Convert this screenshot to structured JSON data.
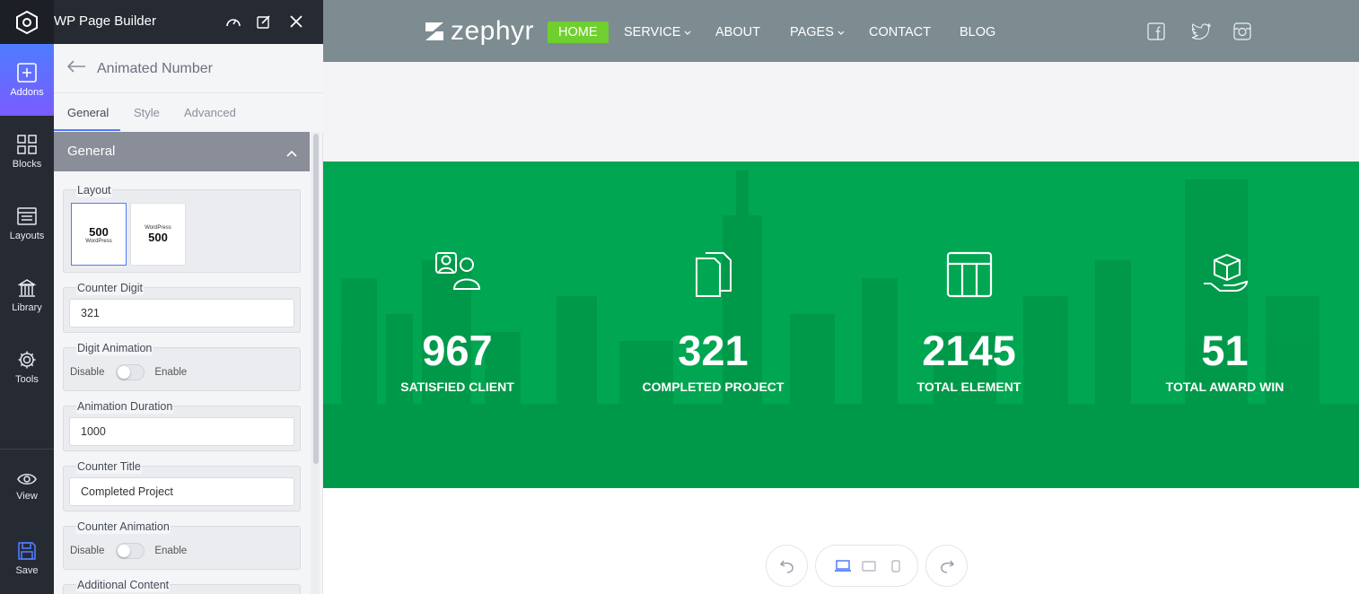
{
  "builder": {
    "title": "WP Page Builder",
    "rail": [
      {
        "label": "Addons",
        "icon": "plus-square-icon",
        "active": true
      },
      {
        "label": "Blocks",
        "icon": "blocks-icon"
      },
      {
        "label": "Layouts",
        "icon": "layouts-icon"
      },
      {
        "label": "Library",
        "icon": "library-icon"
      },
      {
        "label": "Tools",
        "icon": "gear-icon"
      },
      {
        "label": "View",
        "icon": "eye-icon"
      },
      {
        "label": "Save",
        "icon": "floppy-icon"
      }
    ],
    "panel": {
      "addon_title": "Animated Number",
      "tabs": [
        "General",
        "Style",
        "Advanced"
      ],
      "section": "General",
      "layout_label": "Layout",
      "layout_options": [
        {
          "number": "500",
          "caption": "WordPress"
        },
        {
          "number": "500",
          "caption": "WordPress"
        }
      ],
      "counter_digit_label": "Counter Digit",
      "counter_digit_value": "321",
      "digit_animation_label": "Digit Animation",
      "animation_duration_label": "Animation Duration",
      "animation_duration_value": "1000",
      "counter_title_label": "Counter Title",
      "counter_title_value": "Completed Project",
      "counter_animation_label": "Counter Animation",
      "additional_content_label": "Additional Content",
      "toggle_off": "Disable",
      "toggle_on": "Enable"
    }
  },
  "site": {
    "logo_text": "zephyr",
    "nav": [
      {
        "label": "HOME",
        "active": true
      },
      {
        "label": "SERVICE",
        "dropdown": true
      },
      {
        "label": "ABOUT"
      },
      {
        "label": "PAGES",
        "dropdown": true
      },
      {
        "label": "CONTACT"
      },
      {
        "label": "BLOG"
      }
    ],
    "social": [
      "facebook-icon",
      "twitter-icon",
      "instagram-icon"
    ],
    "counters": [
      {
        "number": "967",
        "title": "SATISFIED CLIENT",
        "icon": "users-icon"
      },
      {
        "number": "321",
        "title": "COMPLETED PROJECT",
        "icon": "documents-icon"
      },
      {
        "number": "2145",
        "title": "TOTAL ELEMENT",
        "icon": "layout-grid-icon"
      },
      {
        "number": "51",
        "title": "TOTAL AWARD WIN",
        "icon": "gift-box-hand-icon"
      }
    ]
  },
  "colors": {
    "hero_green": "#00a651",
    "nav_active": "#6fcf2f",
    "header_gray": "#7d8c91",
    "builder_dark": "#262a33",
    "accent_blue": "#4f7cff"
  }
}
